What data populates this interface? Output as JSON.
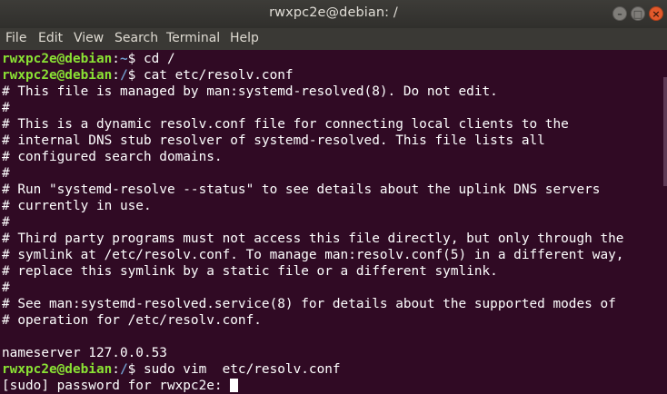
{
  "window": {
    "title": "rwxpc2e@debian: /"
  },
  "menu": {
    "file": "File",
    "edit": "Edit",
    "view": "View",
    "search": "Search",
    "terminal": "Terminal",
    "help": "Help"
  },
  "colors": {
    "terminal_background": "#300a24",
    "prompt_user": "#8ae234",
    "prompt_path": "#729fcf",
    "text": "#ffffff"
  },
  "terminal": {
    "prompt_user": "rwxpc2e@debian",
    "prompt_sep": ":",
    "path_home": "~",
    "path_root": "/",
    "prompt_suffix": "$ ",
    "cmd1": "cd /",
    "cmd2": "cat etc/resolv.conf",
    "output": [
      "# This file is managed by man:systemd-resolved(8). Do not edit.",
      "#",
      "# This is a dynamic resolv.conf file for connecting local clients to the",
      "# internal DNS stub resolver of systemd-resolved. This file lists all",
      "# configured search domains.",
      "#",
      "# Run \"systemd-resolve --status\" to see details about the uplink DNS servers",
      "# currently in use.",
      "#",
      "# Third party programs must not access this file directly, but only through the",
      "# symlink at /etc/resolv.conf. To manage man:resolv.conf(5) in a different way,",
      "# replace this symlink by a static file or a different symlink.",
      "#",
      "# See man:systemd-resolved.service(8) for details about the supported modes of",
      "# operation for /etc/resolv.conf.",
      "",
      "nameserver 127.0.0.53"
    ],
    "cmd3": "sudo vim  etc/resolv.conf",
    "sudo_prompt": "[sudo] password for rwxpc2e: "
  }
}
